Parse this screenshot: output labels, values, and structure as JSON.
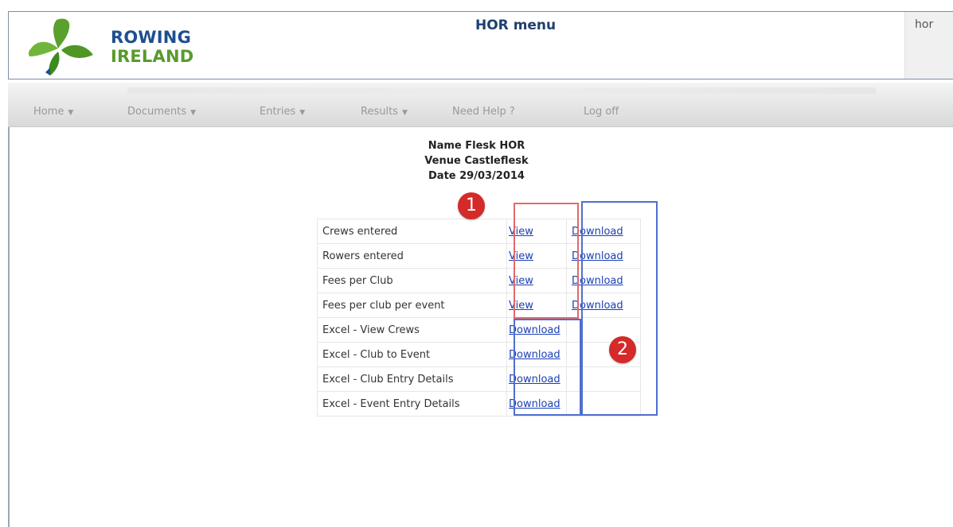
{
  "header": {
    "brand_line1": "ROWING",
    "brand_line2": "IRELAND",
    "title": "HOR menu",
    "user": "hor"
  },
  "nav": {
    "items": [
      {
        "label": "Home",
        "dropdown": true
      },
      {
        "label": "Documents",
        "dropdown": true
      },
      {
        "label": "Entries",
        "dropdown": true
      },
      {
        "label": "Results",
        "dropdown": true
      },
      {
        "label": "Need Help ?",
        "dropdown": false
      },
      {
        "label": "Log off",
        "dropdown": false
      }
    ]
  },
  "info": {
    "name": "Name Flesk HOR",
    "venue": "Venue Castleflesk",
    "date": "Date 29/03/2014"
  },
  "reports": [
    {
      "label": "Crews entered",
      "col1": "View",
      "col2": "Download"
    },
    {
      "label": "Rowers entered",
      "col1": "View",
      "col2": "Download"
    },
    {
      "label": "Fees per Club",
      "col1": "View",
      "col2": "Download"
    },
    {
      "label": "Fees per club per event",
      "col1": "View",
      "col2": "Download"
    },
    {
      "label": "Excel - View Crews",
      "col1": "Download",
      "col2": ""
    },
    {
      "label": "Excel - Club to Event",
      "col1": "Download",
      "col2": ""
    },
    {
      "label": "Excel - Club Entry Details",
      "col1": "Download",
      "col2": ""
    },
    {
      "label": "Excel - Event Entry Details",
      "col1": "Download",
      "col2": ""
    }
  ],
  "annotations": {
    "badge1": "1",
    "badge2": "2"
  },
  "colors": {
    "brand_blue": "#1f4f8f",
    "brand_green": "#5a9a2c",
    "link": "#1a3fb5",
    "annotation_red": "#e06a6a",
    "annotation_blue": "#4f6fcf",
    "badge": "#d42a2a"
  }
}
